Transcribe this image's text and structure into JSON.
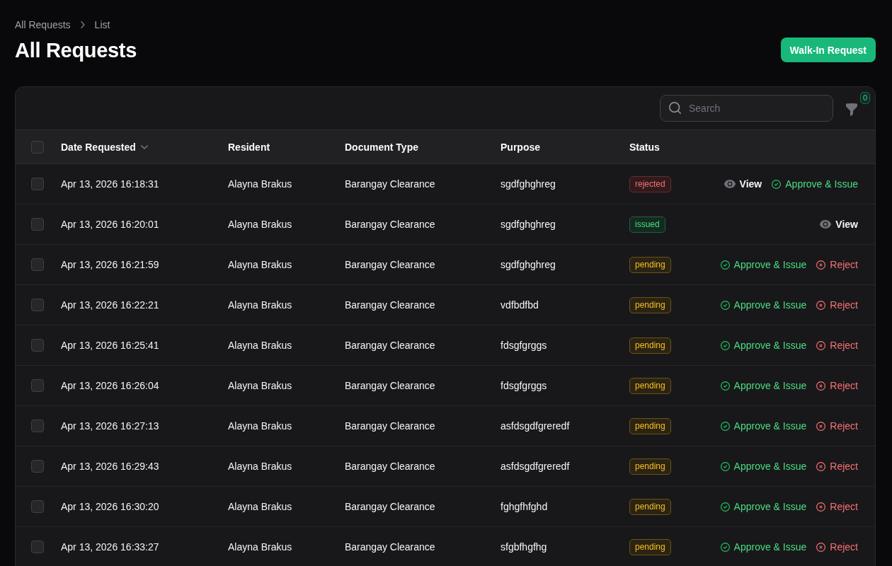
{
  "breadcrumbs": [
    "All Requests",
    "List"
  ],
  "title": "All Requests",
  "header_action": {
    "label": "Walk-In Request"
  },
  "toolbar": {
    "search": {
      "placeholder": "Search"
    },
    "filter_count": "0"
  },
  "table": {
    "select_all": {
      "checked": false
    },
    "columns": [
      {
        "label": "Date Requested",
        "sorted": true
      },
      {
        "label": "Resident",
        "sorted": false
      },
      {
        "label": "Document Type",
        "sorted": false
      },
      {
        "label": "Purpose",
        "sorted": false
      },
      {
        "label": "Status",
        "sorted": false
      }
    ],
    "rows": [
      {
        "checked": false,
        "date": "Apr 13, 2026 16:18:31",
        "resident": "Alayna Brakus",
        "document_type": "Barangay Clearance",
        "purpose": "sgdfghghreg",
        "status": {
          "label": "rejected",
          "kind": "rejected"
        },
        "actions": [
          {
            "kind": "view",
            "label": "View"
          },
          {
            "kind": "approve",
            "label": "Approve & Issue"
          }
        ]
      },
      {
        "checked": false,
        "date": "Apr 13, 2026 16:20:01",
        "resident": "Alayna Brakus",
        "document_type": "Barangay Clearance",
        "purpose": "sgdfghghreg",
        "status": {
          "label": "issued",
          "kind": "issued"
        },
        "actions": [
          {
            "kind": "view",
            "label": "View"
          }
        ]
      },
      {
        "checked": false,
        "date": "Apr 13, 2026 16:21:59",
        "resident": "Alayna Brakus",
        "document_type": "Barangay Clearance",
        "purpose": "sgdfghghreg",
        "status": {
          "label": "pending",
          "kind": "pending"
        },
        "actions": [
          {
            "kind": "approve",
            "label": "Approve & Issue"
          },
          {
            "kind": "reject",
            "label": "Reject"
          }
        ]
      },
      {
        "checked": false,
        "date": "Apr 13, 2026 16:22:21",
        "resident": "Alayna Brakus",
        "document_type": "Barangay Clearance",
        "purpose": "vdfbdfbd",
        "status": {
          "label": "pending",
          "kind": "pending"
        },
        "actions": [
          {
            "kind": "approve",
            "label": "Approve & Issue"
          },
          {
            "kind": "reject",
            "label": "Reject"
          }
        ]
      },
      {
        "checked": false,
        "date": "Apr 13, 2026 16:25:41",
        "resident": "Alayna Brakus",
        "document_type": "Barangay Clearance",
        "purpose": "fdsgfgrggs",
        "status": {
          "label": "pending",
          "kind": "pending"
        },
        "actions": [
          {
            "kind": "approve",
            "label": "Approve & Issue"
          },
          {
            "kind": "reject",
            "label": "Reject"
          }
        ]
      },
      {
        "checked": false,
        "date": "Apr 13, 2026 16:26:04",
        "resident": "Alayna Brakus",
        "document_type": "Barangay Clearance",
        "purpose": "fdsgfgrggs",
        "status": {
          "label": "pending",
          "kind": "pending"
        },
        "actions": [
          {
            "kind": "approve",
            "label": "Approve & Issue"
          },
          {
            "kind": "reject",
            "label": "Reject"
          }
        ]
      },
      {
        "checked": false,
        "date": "Apr 13, 2026 16:27:13",
        "resident": "Alayna Brakus",
        "document_type": "Barangay Clearance",
        "purpose": "asfdsgdfgreredf",
        "status": {
          "label": "pending",
          "kind": "pending"
        },
        "actions": [
          {
            "kind": "approve",
            "label": "Approve & Issue"
          },
          {
            "kind": "reject",
            "label": "Reject"
          }
        ]
      },
      {
        "checked": false,
        "date": "Apr 13, 2026 16:29:43",
        "resident": "Alayna Brakus",
        "document_type": "Barangay Clearance",
        "purpose": "asfdsgdfgreredf",
        "status": {
          "label": "pending",
          "kind": "pending"
        },
        "actions": [
          {
            "kind": "approve",
            "label": "Approve & Issue"
          },
          {
            "kind": "reject",
            "label": "Reject"
          }
        ]
      },
      {
        "checked": false,
        "date": "Apr 13, 2026 16:30:20",
        "resident": "Alayna Brakus",
        "document_type": "Barangay Clearance",
        "purpose": "fghgfhfghd",
        "status": {
          "label": "pending",
          "kind": "pending"
        },
        "actions": [
          {
            "kind": "approve",
            "label": "Approve & Issue"
          },
          {
            "kind": "reject",
            "label": "Reject"
          }
        ]
      },
      {
        "checked": false,
        "date": "Apr 13, 2026 16:33:27",
        "resident": "Alayna Brakus",
        "document_type": "Barangay Clearance",
        "purpose": "sfgbfhgfhg",
        "status": {
          "label": "pending",
          "kind": "pending"
        },
        "actions": [
          {
            "kind": "approve",
            "label": "Approve & Issue"
          },
          {
            "kind": "reject",
            "label": "Reject"
          }
        ]
      }
    ]
  }
}
